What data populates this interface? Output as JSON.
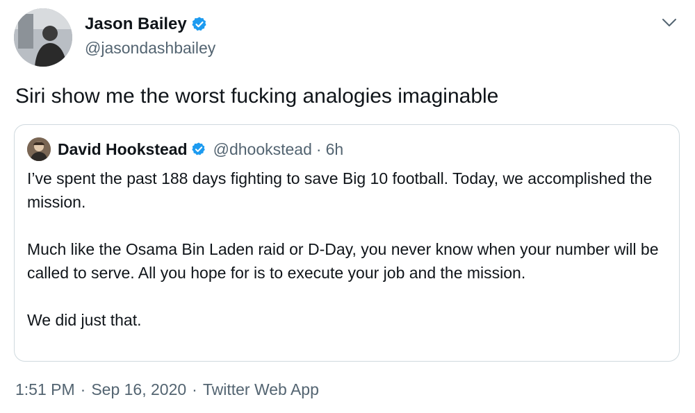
{
  "author": {
    "display_name": "Jason Bailey",
    "handle": "@jasondashbailey",
    "verified": true,
    "avatar_icon": "profile-photo"
  },
  "tweet": {
    "text": "Siri show me the worst fucking analogies imaginable"
  },
  "quoted_tweet": {
    "display_name": "David Hookstead",
    "handle": "@dhookstead",
    "separator": "·",
    "time": "6h",
    "verified": true,
    "paragraphs": [
      "I’ve spent the past 188 days fighting to save Big 10 football. Today, we accomplished the mission.",
      "Much like the Osama Bin Laden raid or D-Day, you never know when your number will be called to serve. All you hope for is to execute your job and the mission.",
      "We did just that."
    ]
  },
  "meta": {
    "time": "1:51 PM",
    "separator": "·",
    "date": "Sep 16, 2020",
    "source": "Twitter Web App"
  },
  "colors": {
    "verified_badge": "#1d9bf0",
    "secondary_text": "#536471",
    "border": "#cfd9de"
  }
}
